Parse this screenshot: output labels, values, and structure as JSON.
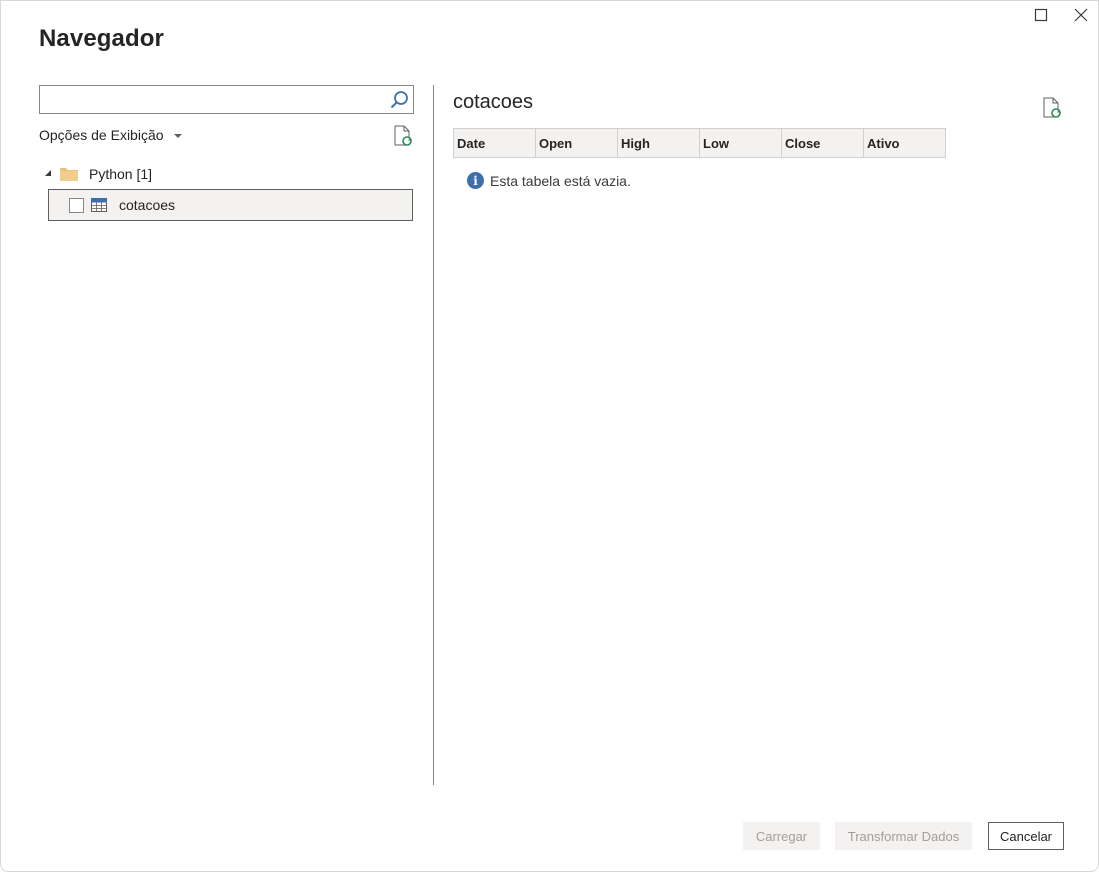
{
  "window": {
    "title": "Navegador"
  },
  "left_pane": {
    "search": {
      "value": "",
      "placeholder": ""
    },
    "display_options_label": "Opções de Exibição",
    "tree": {
      "folder_label": "Python [1]",
      "items": [
        {
          "label": "cotacoes",
          "checked": false,
          "selected": true
        }
      ]
    }
  },
  "preview": {
    "title": "cotacoes",
    "columns": [
      "Date",
      "Open",
      "High",
      "Low",
      "Close",
      "Ativo"
    ],
    "empty_message": "Esta tabela está vazia."
  },
  "footer": {
    "load_label": "Carregar",
    "transform_label": "Transformar Dados",
    "cancel_label": "Cancelar"
  },
  "icons": {
    "maximize": "maximize-icon",
    "close": "close-icon",
    "search": "search-icon",
    "refresh": "refresh-document-icon",
    "folder": "folder-icon",
    "table": "table-icon",
    "info": "info-icon"
  },
  "colors": {
    "info_blue": "#3f6fab",
    "refresh_green": "#2e8a57",
    "folder_yellow": "#e8c27a",
    "disabled_bg": "#f3f2f1",
    "disabled_text": "#a19f9d"
  }
}
